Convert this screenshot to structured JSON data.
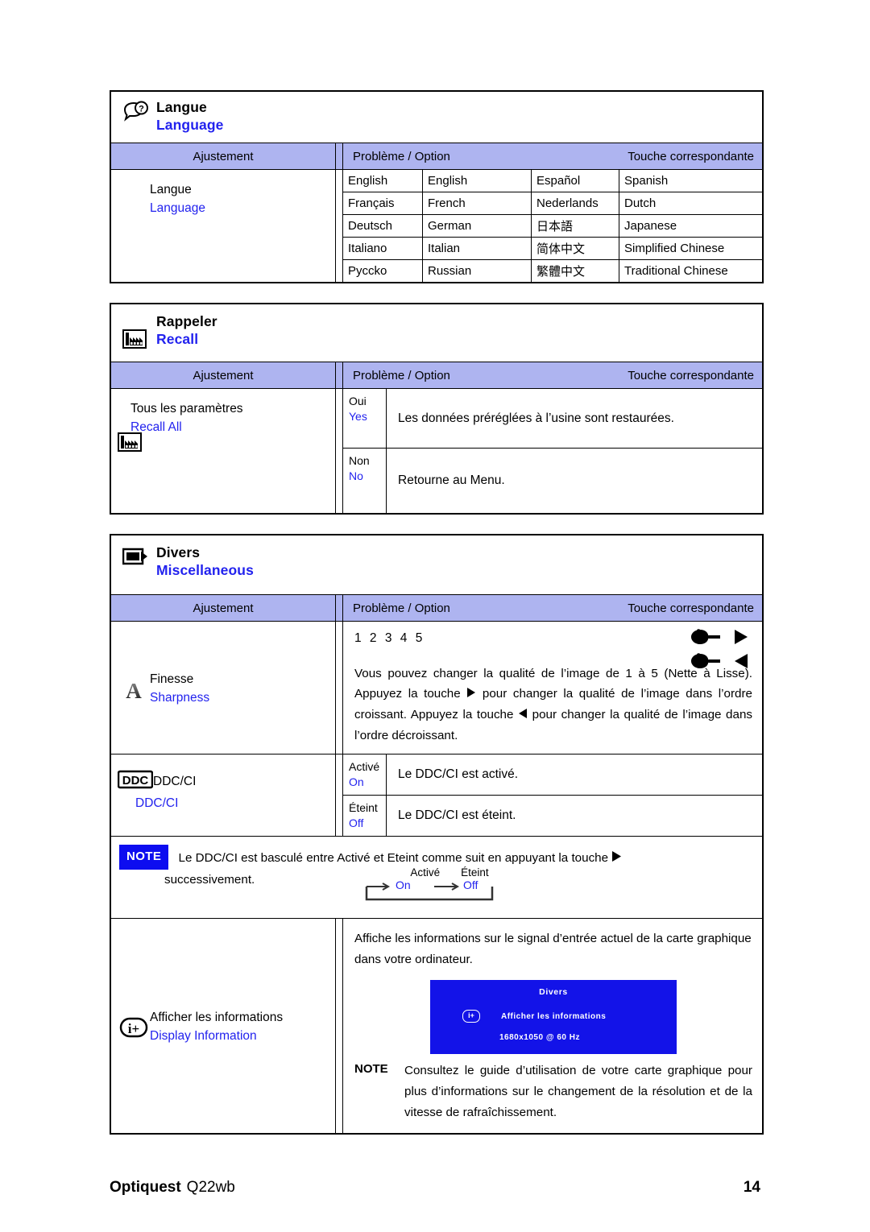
{
  "columns": {
    "adjustment": "Ajustement",
    "problem_option": "Problème / Option",
    "key": "Touche correspondante"
  },
  "sections": [
    {
      "id": "language",
      "icon": "speech-bubble-question-icon",
      "title_fr": "Langue",
      "title_en": "Language",
      "item": {
        "label_fr": "Langue",
        "label_en": "Language"
      },
      "languages": [
        {
          "native_a": "English",
          "english_a": "English",
          "native_b": "Español",
          "english_b": "Spanish"
        },
        {
          "native_a": "Français",
          "english_a": "French",
          "native_b": "Nederlands",
          "english_b": "Dutch"
        },
        {
          "native_a": "Deutsch",
          "english_a": "German",
          "native_b": "日本語",
          "english_b": "Japanese"
        },
        {
          "native_a": "Italiano",
          "english_a": "Italian",
          "native_b": "简体中文",
          "english_b": "Simplified Chinese"
        },
        {
          "native_a": "Pycckо",
          "english_a": "Russian",
          "native_b": "繁體中文",
          "english_b": "Traditional Chinese"
        }
      ]
    },
    {
      "id": "recall",
      "icon": "factory-icon",
      "title_fr": "Rappeler",
      "title_en": "Recall",
      "item": {
        "label_fr": "Tous les paramètres",
        "label_en": "Recall All"
      },
      "options": [
        {
          "key_fr": "Oui",
          "key_en": "Yes",
          "desc": "Les données préréglées à l’usine sont restaurées."
        },
        {
          "key_fr": "Non",
          "key_en": "No",
          "desc": "Retourne au Menu."
        }
      ]
    },
    {
      "id": "miscellaneous",
      "icon": "monitor-arrow-icon",
      "title_fr": "Divers",
      "title_en": "Miscellaneous"
    }
  ],
  "sharpness": {
    "icon": "letter-a-icon",
    "label_fr": "Finesse",
    "label_en": "Sharpness",
    "scale": "1 2 3 4 5",
    "description": "Vous pouvez changer la qualité de l’image de 1 à 5 (Nette à Lisse). Appuyez la touche ▶ pour changer la qualité de l’image dans l’ordre croissant. Appuyez la touche ◀ pour changer la qualité de l’image dans l’ordre décroissant.",
    "desc_part1": "Vous pouvez changer la qualité de l’image de 1 à 5 (Nette à Lisse). Appuyez la touche ",
    "desc_part2": " pour changer la qualité de l’image dans l’ordre croissant. Appuyez la touche ",
    "desc_part3": " pour changer la qualité de l’image dans l’ordre décroissant."
  },
  "ddcci": {
    "icon": "ddc-badge-icon",
    "label_fr": "DDC/CI",
    "label_en": "DDC/CI",
    "options": [
      {
        "key_fr": "Activé",
        "key_en": "On",
        "desc": "Le DDC/CI est activé."
      },
      {
        "key_fr": "Éteint",
        "key_en": "Off",
        "desc": "Le DDC/CI est éteint."
      }
    ],
    "note_badge": "NOTE",
    "note_text_1": "Le DDC/CI est basculé entre Activé et Eteint comme suit en appuyant la touche ",
    "note_text_2": "successivement.",
    "toggle": {
      "label_on_fr": "Activé",
      "label_off_fr": "Éteint",
      "label_on_en": "On",
      "label_off_en": "Off"
    }
  },
  "display_information": {
    "icon": "info-plus-icon",
    "label_fr": "Afficher les informations",
    "label_en": "Display Information",
    "description": "Affiche les informations sur le signal d’entrée actuel de la carte graphique dans votre ordinateur.",
    "osd": {
      "title": "Divers",
      "icon": "info-plus-icon",
      "row_label": "Afficher les informations",
      "resolution": "1680x1050  @ 60 Hz",
      "background_color": "#1313e8"
    },
    "note_badge": "NOTE",
    "note_text": "Consultez le guide d’utilisation de votre carte graphique pour plus d’informations sur le changement de la résolution et de la vitesse de rafraîchissement."
  },
  "footer": {
    "brand": "Optiquest",
    "model": "Q22wb",
    "page": "14"
  },
  "colors": {
    "header_band": "#aeb4f0",
    "english_blue": "#2222ee",
    "note_blue": "#0d0df0",
    "osd_blue": "#1313e8"
  }
}
